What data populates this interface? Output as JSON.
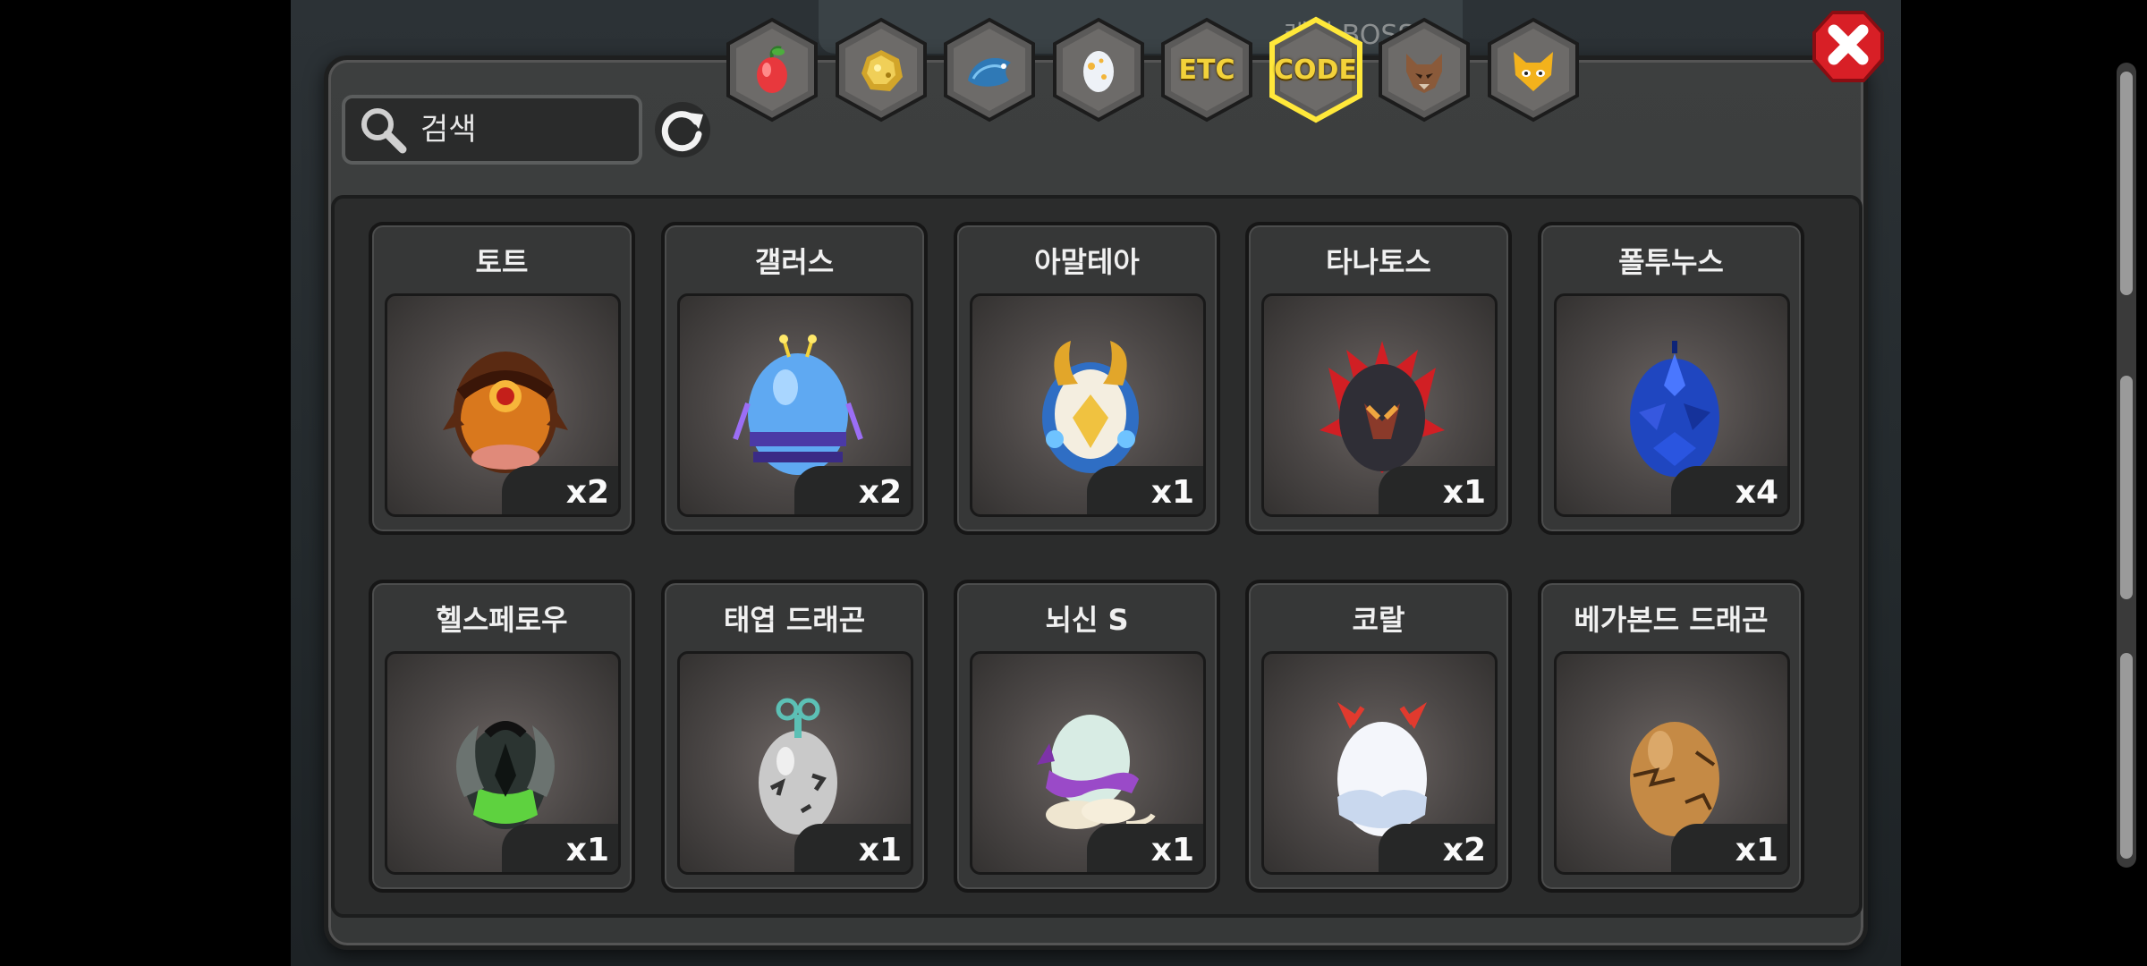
{
  "header": {
    "background_text": "레벨 BOSS",
    "tabs": [
      {
        "name": "fruit",
        "icon": "red-fruit-icon",
        "label": "",
        "selected": false
      },
      {
        "name": "gold",
        "icon": "gold-ore-icon",
        "label": "",
        "selected": false
      },
      {
        "name": "dragon",
        "icon": "blue-dragon-icon",
        "label": "",
        "selected": false
      },
      {
        "name": "egg",
        "icon": "egg-icon",
        "label": "",
        "selected": false
      },
      {
        "name": "etc",
        "icon": "",
        "label": "ETC",
        "selected": false
      },
      {
        "name": "code",
        "icon": "",
        "label": "CODE",
        "selected": true
      },
      {
        "name": "wolf",
        "icon": "wolf-head-icon",
        "label": "",
        "selected": false
      },
      {
        "name": "cat",
        "icon": "cat-face-icon",
        "label": "",
        "selected": false
      }
    ]
  },
  "search": {
    "placeholder": "검색",
    "icon": "search-icon"
  },
  "refresh": {
    "icon": "refresh-icon"
  },
  "close": {
    "icon": "close-icon",
    "color": "#d81f26"
  },
  "colors": {
    "accent_yellow": "#f3d23a",
    "selected_tab_border": "#ffe83a"
  },
  "items": [
    {
      "name": "토트",
      "qty": "x2",
      "egg": "orange-dark-armored-egg"
    },
    {
      "name": "갤러스",
      "qty": "x2",
      "egg": "blue-purple-striped-egg"
    },
    {
      "name": "아말테아",
      "qty": "x1",
      "egg": "gold-horned-blue-egg"
    },
    {
      "name": "타나토스",
      "qty": "x1",
      "egg": "dark-red-spiked-egg"
    },
    {
      "name": "폴투누스",
      "qty": "x4",
      "egg": "blue-scaled-egg"
    },
    {
      "name": "헬스페로우",
      "qty": "x1",
      "egg": "green-black-clawed-egg"
    },
    {
      "name": "태엽 드래곤",
      "qty": "x1",
      "egg": "windup-cracked-egg"
    },
    {
      "name": "뇌신 S",
      "qty": "x1",
      "egg": "cloud-scarf-egg"
    },
    {
      "name": "코랄",
      "qty": "x2",
      "egg": "white-red-horned-egg"
    },
    {
      "name": "베가본드 드래곤",
      "qty": "x1",
      "egg": "brown-cracked-egg"
    }
  ]
}
